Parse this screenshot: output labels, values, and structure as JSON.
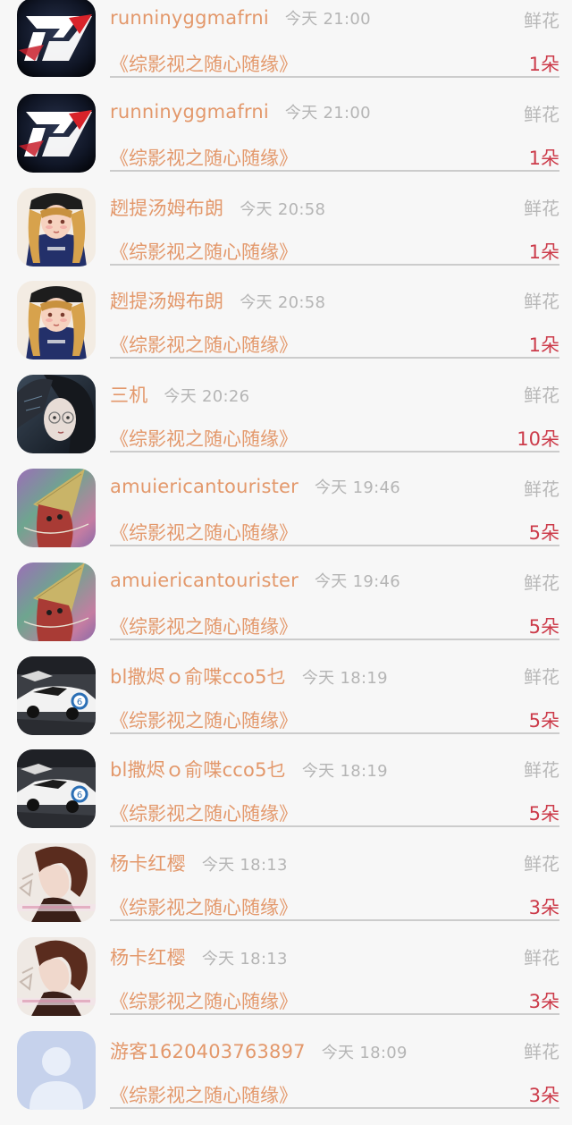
{
  "rows": [
    {
      "name": "runninyggmafrni",
      "time": "今天 21:00",
      "gift": "鲜花",
      "title": "《综影视之随心随缘》",
      "count": "1朵",
      "avatar": "racing-game-logo"
    },
    {
      "name": "runninyggmafrni",
      "time": "今天 21:00",
      "gift": "鲜花",
      "title": "《综影视之随心随缘》",
      "count": "1朵",
      "avatar": "racing-game-logo"
    },
    {
      "name": "趔提汤姆布朗",
      "time": "今天 20:58",
      "gift": "鲜花",
      "title": "《综影视之随心随缘》",
      "count": "1朵",
      "avatar": "anime-girl-blonde"
    },
    {
      "name": "趔提汤姆布朗",
      "time": "今天 20:58",
      "gift": "鲜花",
      "title": "《综影视之随心随缘》",
      "count": "1朵",
      "avatar": "anime-girl-blonde"
    },
    {
      "name": "三机",
      "time": "今天 20:26",
      "gift": "鲜花",
      "title": "《综影视之随心随缘》",
      "count": "10朵",
      "avatar": "girl-glasses"
    },
    {
      "name": "amuiericantourister",
      "time": "今天 19:46",
      "gift": "鲜花",
      "title": "《综影视之随心随缘》",
      "count": "5朵",
      "avatar": "party-hat-cartoon"
    },
    {
      "name": "amuiericantourister",
      "time": "今天 19:46",
      "gift": "鲜花",
      "title": "《综影视之随心随缘》",
      "count": "5朵",
      "avatar": "party-hat-cartoon"
    },
    {
      "name": "bl撒烬ｏ俞喋cco5乜",
      "time": "今天 18:19",
      "gift": "鲜花",
      "title": "《综影视之随心随缘》",
      "count": "5朵",
      "avatar": "race-cars"
    },
    {
      "name": "bl撒烬ｏ俞喋cco5乜",
      "time": "今天 18:19",
      "gift": "鲜花",
      "title": "《综影视之随心随缘》",
      "count": "5朵",
      "avatar": "race-cars"
    },
    {
      "name": "杨卡红樱",
      "time": "今天 18:13",
      "gift": "鲜花",
      "title": "《综影视之随心随缘》",
      "count": "3朵",
      "avatar": "girl-brown-hair"
    },
    {
      "name": "杨卡红樱",
      "time": "今天 18:13",
      "gift": "鲜花",
      "title": "《综影视之随心随缘》",
      "count": "3朵",
      "avatar": "girl-brown-hair"
    },
    {
      "name": "游客1620403763897",
      "time": "今天 18:09",
      "gift": "鲜花",
      "title": "《综影视之随心随缘》",
      "count": "3朵",
      "avatar": "default-user"
    }
  ]
}
